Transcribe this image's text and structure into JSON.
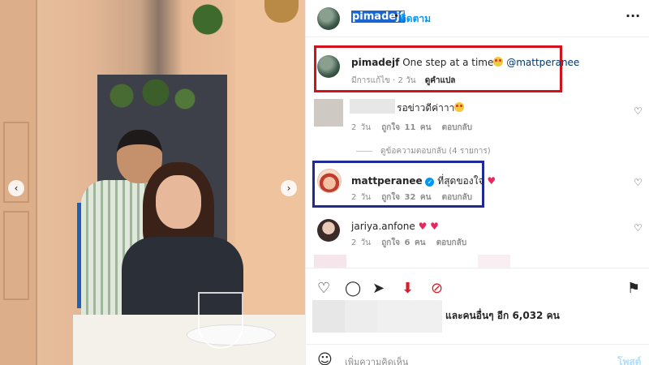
{
  "header": {
    "username": "pimadejf",
    "separator": "•",
    "follow_label": "ติดตาม",
    "more_label": "···"
  },
  "photo": {
    "prev_label": "‹",
    "next_label": "›"
  },
  "caption": {
    "username": "pimadejf",
    "text": "One step at a time",
    "mention": "@mattperanee",
    "edited_age": "มีการแก้ไข · 2 วัน",
    "translate_label": "ดูคำแปล"
  },
  "comments": [
    {
      "text": "รอข่าวดีค่าาา",
      "age": "2 วัน",
      "likes": "ถูกใจ 11 คน",
      "reply_label": "ตอบกลับ"
    }
  ],
  "view_replies": "ดูข้อความตอบกลับ (4 รายการ)",
  "reply": {
    "username": "mattperanee",
    "text": "ที่สุดของใจ",
    "age": "2 วัน",
    "likes": "ถูกใจ 32 คน",
    "reply_label": "ตอบกลับ"
  },
  "comment3": {
    "username": "jariya.anfone",
    "age": "2 วัน",
    "likes": "ถูกใจ 6 คน",
    "reply_label": "ตอบกลับ"
  },
  "likes_summary": "และคนอื่นๆ อีก 6,032 คน",
  "add_comment": {
    "placeholder": "เพิ่มความคิดเห็น",
    "post_label": "โพสต์"
  },
  "colors": {
    "caption_highlight": "#d0121b",
    "reply_highlight": "#1f2a96",
    "link_blue": "#0095f6",
    "selection_blue": "#1a66d1",
    "heart_pink": "#e6285c"
  }
}
